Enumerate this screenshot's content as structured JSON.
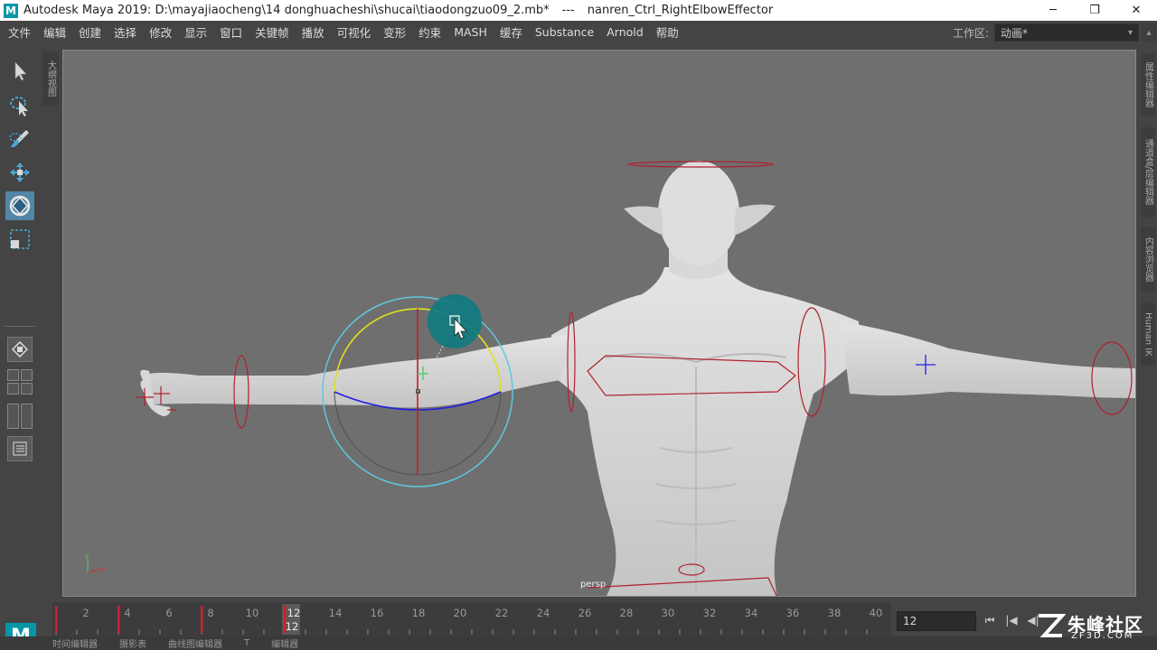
{
  "window": {
    "app_title": "Autodesk Maya 2019: D:\\mayajiaocheng\\14 donghuacheshi\\shucai\\tiaodongzuo09_2.mb*",
    "separator": "---",
    "selected_object": "nanren_Ctrl_RightElbowEffector",
    "logo_letter": "M",
    "minimize": "─",
    "maximize": "❐",
    "close": "✕"
  },
  "menubar": {
    "items": [
      "文件",
      "编辑",
      "创建",
      "选择",
      "修改",
      "显示",
      "窗口",
      "关键帧",
      "播放",
      "可视化",
      "变形",
      "约束",
      "MASH",
      "缓存",
      "Substance",
      "Arnold",
      "帮助"
    ]
  },
  "workspace": {
    "label": "工作区:",
    "value": "动画*",
    "chevron": "▾"
  },
  "toolbox": {
    "tools": [
      {
        "name": "select-tool",
        "icon": "arrow-icon",
        "active": false
      },
      {
        "name": "lasso-tool",
        "icon": "lasso-icon",
        "active": false
      },
      {
        "name": "paint-select-tool",
        "icon": "brush-icon",
        "active": false
      },
      {
        "name": "move-tool",
        "icon": "move-icon",
        "active": false
      },
      {
        "name": "rotate-tool",
        "icon": "rotate-icon",
        "active": true
      },
      {
        "name": "scale-tool",
        "icon": "scale-icon",
        "active": false
      }
    ]
  },
  "side_panels": {
    "outliner": "大纲视图",
    "attribute_editor": "属性编辑器",
    "channel_box": "通道盒/层编辑器",
    "content_browser": "内容浏览器",
    "human_ik": "Human IK"
  },
  "viewport": {
    "camera_label": "persp",
    "background_color": "#6f6f6f",
    "control_color": "#b0202e",
    "rotate_ring_colors": {
      "outer": "#5ec8e0",
      "x": "#e0e020",
      "y": "#2020e0",
      "z": "#c02020"
    }
  },
  "timeline": {
    "frame_labels": [
      "2",
      "4",
      "6",
      "8",
      "10",
      "12",
      "14",
      "16",
      "18",
      "20",
      "22",
      "24",
      "26",
      "28",
      "30",
      "32",
      "34",
      "36",
      "38",
      "40"
    ],
    "keyframes": [
      1,
      4,
      8,
      12
    ],
    "current_frame": "12",
    "current_frame_field": "12",
    "playback_buttons": [
      "⏮",
      "|◀",
      "◀|"
    ]
  },
  "bottom_tabs": [
    "时间编辑器",
    "摄影表",
    "曲线图编辑器",
    "T",
    "编辑器"
  ],
  "watermark": {
    "title": "朱峰社区",
    "subtitle": "ZF3D.COM"
  }
}
